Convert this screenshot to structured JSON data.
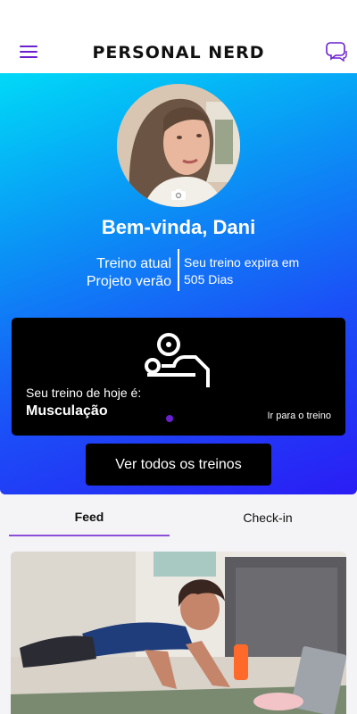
{
  "header": {
    "brand": "PERSONAL NERD",
    "menu_icon": "hamburger-menu-icon",
    "chat_icon": "chat-bubbles-icon"
  },
  "profile": {
    "greeting": "Bem-vinda, Dani",
    "current_label": "Treino atual",
    "current_name": "Projeto verão",
    "expire_line1": "Seu treino expira em",
    "expire_line2": "505 Dias"
  },
  "today_card": {
    "subtitle": "Seu treino de hoje é:",
    "title": "Musculação",
    "link": "Ir para o treino",
    "icon": "bench-press-icon"
  },
  "all_workouts_button": "Ver todos os treinos",
  "tabs": {
    "feed": "Feed",
    "checkin": "Check-in",
    "active": "feed"
  },
  "colors": {
    "accent": "#6a1fd0",
    "gradient_start": "#00d9f7",
    "gradient_end": "#2a1df5"
  }
}
